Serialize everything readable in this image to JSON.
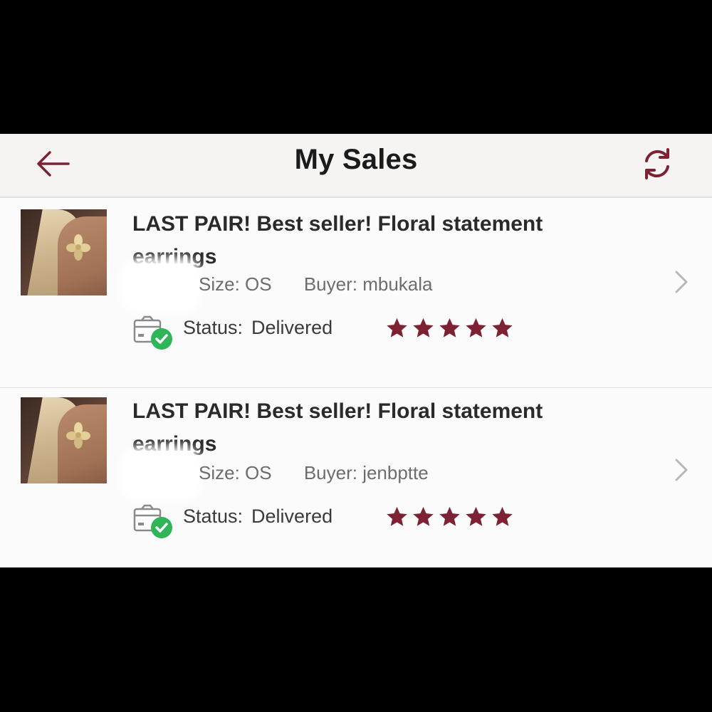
{
  "header": {
    "title": "My Sales",
    "back_icon": "arrow-left-icon",
    "refresh_icon": "refresh-icon"
  },
  "colors": {
    "accent": "#7d2233",
    "success": "#2fb457"
  },
  "sales": [
    {
      "title": "LAST PAIR! Best seller! Floral statement earrings",
      "size": "Size: OS",
      "buyer": "Buyer: mbukala",
      "status_label": "Status:",
      "status_value": "Delivered",
      "rating": 5
    },
    {
      "title": "LAST PAIR! Best seller! Floral statement earrings",
      "size": "Size: OS",
      "buyer": "Buyer: jenbptte",
      "status_label": "Status:",
      "status_value": "Delivered",
      "rating": 5
    }
  ]
}
